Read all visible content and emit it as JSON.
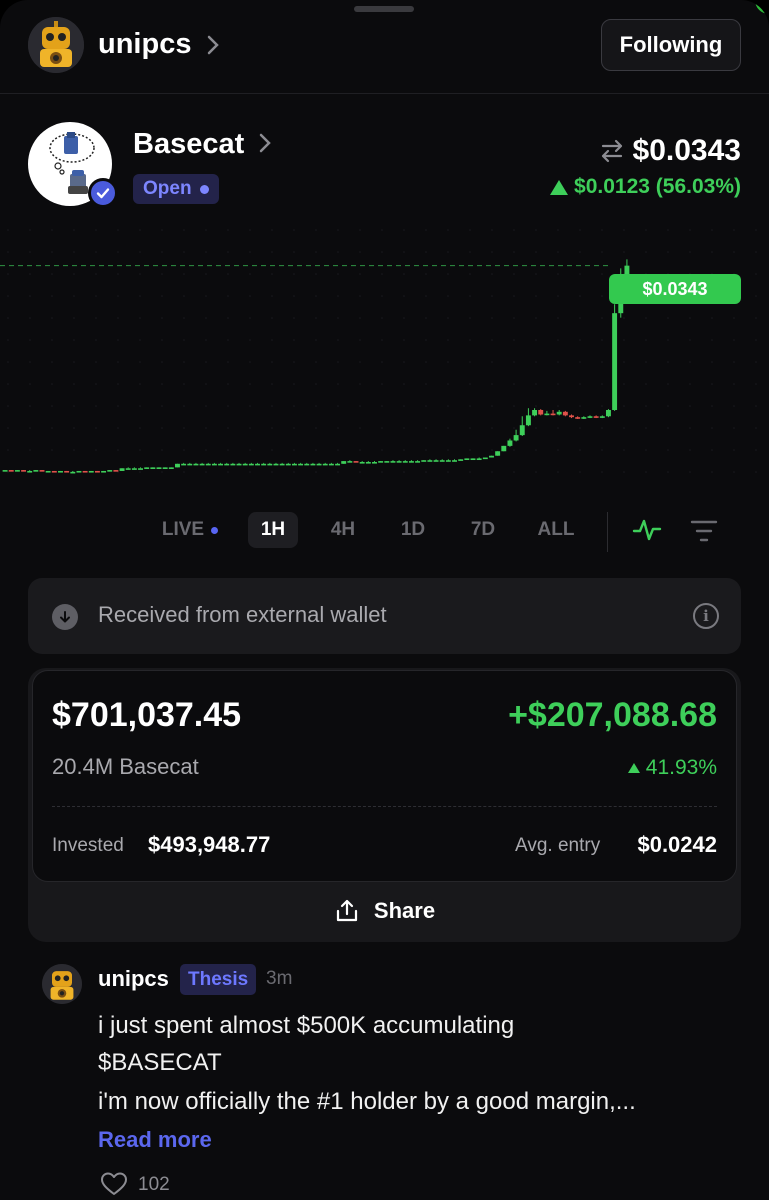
{
  "header": {
    "username": "unipcs",
    "follow_label": "Following"
  },
  "token": {
    "name": "Basecat",
    "status": "Open",
    "price": "$0.0343",
    "change": "$0.0123 (56.03%)",
    "price_tag": "$0.0343"
  },
  "colors": {
    "up": "#3ecf5a",
    "down": "#e0524a",
    "accent": "#5865f2",
    "background": "#0b0b0d"
  },
  "chart_data": {
    "type": "candlestick",
    "current_price": 0.0343,
    "candles": [
      {
        "o": 0.0115,
        "c": 0.0115,
        "h": 0.0115,
        "l": 0.0115
      },
      {
        "o": 0.0115,
        "c": 0.0114,
        "h": 0.0115,
        "l": 0.0114
      },
      {
        "o": 0.0114,
        "c": 0.0115,
        "h": 0.0115,
        "l": 0.0114
      },
      {
        "o": 0.0115,
        "c": 0.0114,
        "h": 0.0115,
        "l": 0.0114
      },
      {
        "o": 0.0114,
        "c": 0.0114,
        "h": 0.0115,
        "l": 0.0114
      },
      {
        "o": 0.0114,
        "c": 0.0115,
        "h": 0.0115,
        "l": 0.0114
      },
      {
        "o": 0.0115,
        "c": 0.0114,
        "h": 0.0115,
        "l": 0.0114
      },
      {
        "o": 0.0114,
        "c": 0.0114,
        "h": 0.0114,
        "l": 0.0113
      },
      {
        "o": 0.0114,
        "c": 0.0113,
        "h": 0.0114,
        "l": 0.0113
      },
      {
        "o": 0.0113,
        "c": 0.0114,
        "h": 0.0114,
        "l": 0.0113
      },
      {
        "o": 0.0114,
        "c": 0.0113,
        "h": 0.0114,
        "l": 0.0113
      },
      {
        "o": 0.0113,
        "c": 0.0113,
        "h": 0.0114,
        "l": 0.0112
      },
      {
        "o": 0.0113,
        "c": 0.0114,
        "h": 0.0114,
        "l": 0.0113
      },
      {
        "o": 0.0114,
        "c": 0.0113,
        "h": 0.0114,
        "l": 0.0113
      },
      {
        "o": 0.0113,
        "c": 0.0114,
        "h": 0.0114,
        "l": 0.0113
      },
      {
        "o": 0.0114,
        "c": 0.0113,
        "h": 0.0114,
        "l": 0.0113
      },
      {
        "o": 0.0113,
        "c": 0.0114,
        "h": 0.0114,
        "l": 0.0113
      },
      {
        "o": 0.0114,
        "c": 0.0115,
        "h": 0.0115,
        "l": 0.0114
      },
      {
        "o": 0.0115,
        "c": 0.0114,
        "h": 0.0115,
        "l": 0.0114
      },
      {
        "o": 0.0114,
        "c": 0.0117,
        "h": 0.0117,
        "l": 0.0114
      },
      {
        "o": 0.0117,
        "c": 0.0117,
        "h": 0.0118,
        "l": 0.0117
      },
      {
        "o": 0.0117,
        "c": 0.0117,
        "h": 0.0118,
        "l": 0.0117
      },
      {
        "o": 0.0117,
        "c": 0.0117,
        "h": 0.0118,
        "l": 0.0117
      },
      {
        "o": 0.0117,
        "c": 0.0118,
        "h": 0.0118,
        "l": 0.0117
      },
      {
        "o": 0.0118,
        "c": 0.0118,
        "h": 0.0118,
        "l": 0.0117
      },
      {
        "o": 0.0118,
        "c": 0.0118,
        "h": 0.0118,
        "l": 0.0117
      },
      {
        "o": 0.0118,
        "c": 0.0118,
        "h": 0.0118,
        "l": 0.0117
      },
      {
        "o": 0.0118,
        "c": 0.0118,
        "h": 0.0118,
        "l": 0.0117
      },
      {
        "o": 0.0118,
        "c": 0.0122,
        "h": 0.0122,
        "l": 0.0118
      },
      {
        "o": 0.0122,
        "c": 0.0122,
        "h": 0.0123,
        "l": 0.0122
      },
      {
        "o": 0.0122,
        "c": 0.0122,
        "h": 0.0123,
        "l": 0.0122
      },
      {
        "o": 0.0122,
        "c": 0.0122,
        "h": 0.0123,
        "l": 0.0122
      },
      {
        "o": 0.0122,
        "c": 0.0122,
        "h": 0.0123,
        "l": 0.0122
      },
      {
        "o": 0.0122,
        "c": 0.0122,
        "h": 0.0123,
        "l": 0.0122
      },
      {
        "o": 0.0122,
        "c": 0.0122,
        "h": 0.0123,
        "l": 0.0122
      },
      {
        "o": 0.0122,
        "c": 0.0122,
        "h": 0.0123,
        "l": 0.0122
      },
      {
        "o": 0.0122,
        "c": 0.0122,
        "h": 0.0123,
        "l": 0.0122
      },
      {
        "o": 0.0122,
        "c": 0.0122,
        "h": 0.0123,
        "l": 0.0122
      },
      {
        "o": 0.0122,
        "c": 0.0122,
        "h": 0.0123,
        "l": 0.0122
      },
      {
        "o": 0.0122,
        "c": 0.0122,
        "h": 0.0123,
        "l": 0.0122
      },
      {
        "o": 0.0122,
        "c": 0.0122,
        "h": 0.0123,
        "l": 0.0122
      },
      {
        "o": 0.0122,
        "c": 0.0122,
        "h": 0.0123,
        "l": 0.0122
      },
      {
        "o": 0.0122,
        "c": 0.0122,
        "h": 0.0123,
        "l": 0.0122
      },
      {
        "o": 0.0122,
        "c": 0.0122,
        "h": 0.0123,
        "l": 0.0122
      },
      {
        "o": 0.0122,
        "c": 0.0122,
        "h": 0.0123,
        "l": 0.0122
      },
      {
        "o": 0.0122,
        "c": 0.0122,
        "h": 0.0123,
        "l": 0.0122
      },
      {
        "o": 0.0122,
        "c": 0.0122,
        "h": 0.0123,
        "l": 0.0122
      },
      {
        "o": 0.0122,
        "c": 0.0122,
        "h": 0.0123,
        "l": 0.0122
      },
      {
        "o": 0.0122,
        "c": 0.0122,
        "h": 0.0123,
        "l": 0.0122
      },
      {
        "o": 0.0122,
        "c": 0.0122,
        "h": 0.0123,
        "l": 0.0122
      },
      {
        "o": 0.0122,
        "c": 0.0122,
        "h": 0.0123,
        "l": 0.0122
      },
      {
        "o": 0.0122,
        "c": 0.0122,
        "h": 0.0123,
        "l": 0.0122
      },
      {
        "o": 0.0122,
        "c": 0.0122,
        "h": 0.0123,
        "l": 0.0122
      },
      {
        "o": 0.0122,
        "c": 0.0122,
        "h": 0.0123,
        "l": 0.0122
      },
      {
        "o": 0.0122,
        "c": 0.0122,
        "h": 0.0123,
        "l": 0.0122
      },
      {
        "o": 0.0122,
        "c": 0.0125,
        "h": 0.0125,
        "l": 0.0122
      },
      {
        "o": 0.0125,
        "c": 0.0125,
        "h": 0.0126,
        "l": 0.0124
      },
      {
        "o": 0.0125,
        "c": 0.0124,
        "h": 0.0125,
        "l": 0.0124
      },
      {
        "o": 0.0124,
        "c": 0.0124,
        "h": 0.0125,
        "l": 0.0124
      },
      {
        "o": 0.0124,
        "c": 0.0124,
        "h": 0.0125,
        "l": 0.0124
      },
      {
        "o": 0.0124,
        "c": 0.0124,
        "h": 0.0125,
        "l": 0.0124
      },
      {
        "o": 0.0124,
        "c": 0.0125,
        "h": 0.0125,
        "l": 0.0124
      },
      {
        "o": 0.0125,
        "c": 0.0125,
        "h": 0.0125,
        "l": 0.0124
      },
      {
        "o": 0.0125,
        "c": 0.0125,
        "h": 0.0126,
        "l": 0.0124
      },
      {
        "o": 0.0125,
        "c": 0.0125,
        "h": 0.0126,
        "l": 0.0124
      },
      {
        "o": 0.0125,
        "c": 0.0125,
        "h": 0.0126,
        "l": 0.0124
      },
      {
        "o": 0.0125,
        "c": 0.0125,
        "h": 0.0126,
        "l": 0.0124
      },
      {
        "o": 0.0125,
        "c": 0.0125,
        "h": 0.0126,
        "l": 0.0124
      },
      {
        "o": 0.0125,
        "c": 0.0126,
        "h": 0.0126,
        "l": 0.0125
      },
      {
        "o": 0.0126,
        "c": 0.0126,
        "h": 0.0127,
        "l": 0.0125
      },
      {
        "o": 0.0126,
        "c": 0.0126,
        "h": 0.0127,
        "l": 0.0125
      },
      {
        "o": 0.0126,
        "c": 0.0126,
        "h": 0.0127,
        "l": 0.0125
      },
      {
        "o": 0.0126,
        "c": 0.0126,
        "h": 0.0127,
        "l": 0.0125
      },
      {
        "o": 0.0126,
        "c": 0.0126,
        "h": 0.0127,
        "l": 0.0125
      },
      {
        "o": 0.0126,
        "c": 0.0127,
        "h": 0.0127,
        "l": 0.0126
      },
      {
        "o": 0.0127,
        "c": 0.0128,
        "h": 0.0128,
        "l": 0.0127
      },
      {
        "o": 0.0128,
        "c": 0.0128,
        "h": 0.0128,
        "l": 0.0127
      },
      {
        "o": 0.0128,
        "c": 0.0128,
        "h": 0.0129,
        "l": 0.0127
      },
      {
        "o": 0.0128,
        "c": 0.0129,
        "h": 0.0129,
        "l": 0.0128
      },
      {
        "o": 0.0129,
        "c": 0.0131,
        "h": 0.0131,
        "l": 0.0129
      },
      {
        "o": 0.0131,
        "c": 0.0136,
        "h": 0.0136,
        "l": 0.0131
      },
      {
        "o": 0.0136,
        "c": 0.0142,
        "h": 0.0142,
        "l": 0.0136
      },
      {
        "o": 0.0142,
        "c": 0.0148,
        "h": 0.015,
        "l": 0.0141
      },
      {
        "o": 0.0148,
        "c": 0.0154,
        "h": 0.016,
        "l": 0.0147
      },
      {
        "o": 0.0154,
        "c": 0.0165,
        "h": 0.0175,
        "l": 0.0153
      },
      {
        "o": 0.0165,
        "c": 0.0176,
        "h": 0.0184,
        "l": 0.0164
      },
      {
        "o": 0.0176,
        "c": 0.0182,
        "h": 0.0184,
        "l": 0.0175
      },
      {
        "o": 0.0182,
        "c": 0.0177,
        "h": 0.0183,
        "l": 0.0176
      },
      {
        "o": 0.0177,
        "c": 0.0178,
        "h": 0.0181,
        "l": 0.0176
      },
      {
        "o": 0.0178,
        "c": 0.0177,
        "h": 0.0182,
        "l": 0.0176
      },
      {
        "o": 0.0177,
        "c": 0.018,
        "h": 0.0182,
        "l": 0.0176
      },
      {
        "o": 0.018,
        "c": 0.0176,
        "h": 0.0181,
        "l": 0.0175
      },
      {
        "o": 0.0176,
        "c": 0.0174,
        "h": 0.0177,
        "l": 0.0173
      },
      {
        "o": 0.0174,
        "c": 0.0173,
        "h": 0.0175,
        "l": 0.0172
      },
      {
        "o": 0.0173,
        "c": 0.0174,
        "h": 0.0175,
        "l": 0.0172
      },
      {
        "o": 0.0174,
        "c": 0.0175,
        "h": 0.0176,
        "l": 0.0173
      },
      {
        "o": 0.0175,
        "c": 0.0174,
        "h": 0.0176,
        "l": 0.0173
      },
      {
        "o": 0.0174,
        "c": 0.0175,
        "h": 0.0176,
        "l": 0.0173
      },
      {
        "o": 0.0175,
        "c": 0.0182,
        "h": 0.0183,
        "l": 0.0174
      },
      {
        "o": 0.0182,
        "c": 0.029,
        "h": 0.03,
        "l": 0.0181
      },
      {
        "o": 0.029,
        "c": 0.033,
        "h": 0.034,
        "l": 0.0285
      },
      {
        "o": 0.033,
        "c": 0.0343,
        "h": 0.035,
        "l": 0.0325
      }
    ],
    "ylim": [
      0.0095,
      0.0385
    ]
  },
  "timeframes": {
    "live": "LIVE",
    "h1": "1H",
    "h4": "4H",
    "d1": "1D",
    "d7": "7D",
    "all": "ALL",
    "active": "1H"
  },
  "received": {
    "text": "Received from external wallet"
  },
  "position": {
    "value": "$701,037.45",
    "pnl": "+$207,088.68",
    "amount": "20.4M Basecat",
    "pnl_pct": "41.93%",
    "invested_label": "Invested",
    "invested_value": "$493,948.77",
    "avg_label": "Avg. entry",
    "avg_value": "$0.0242",
    "share_label": "Share"
  },
  "post": {
    "author": "unipcs",
    "tag": "Thesis",
    "time": "3m",
    "line1": "i just spent almost $500K accumulating",
    "line2": "$BASECAT",
    "line3": "i'm now officially the #1 holder by a good margin,...",
    "read_more": "Read more",
    "likes": "102"
  }
}
